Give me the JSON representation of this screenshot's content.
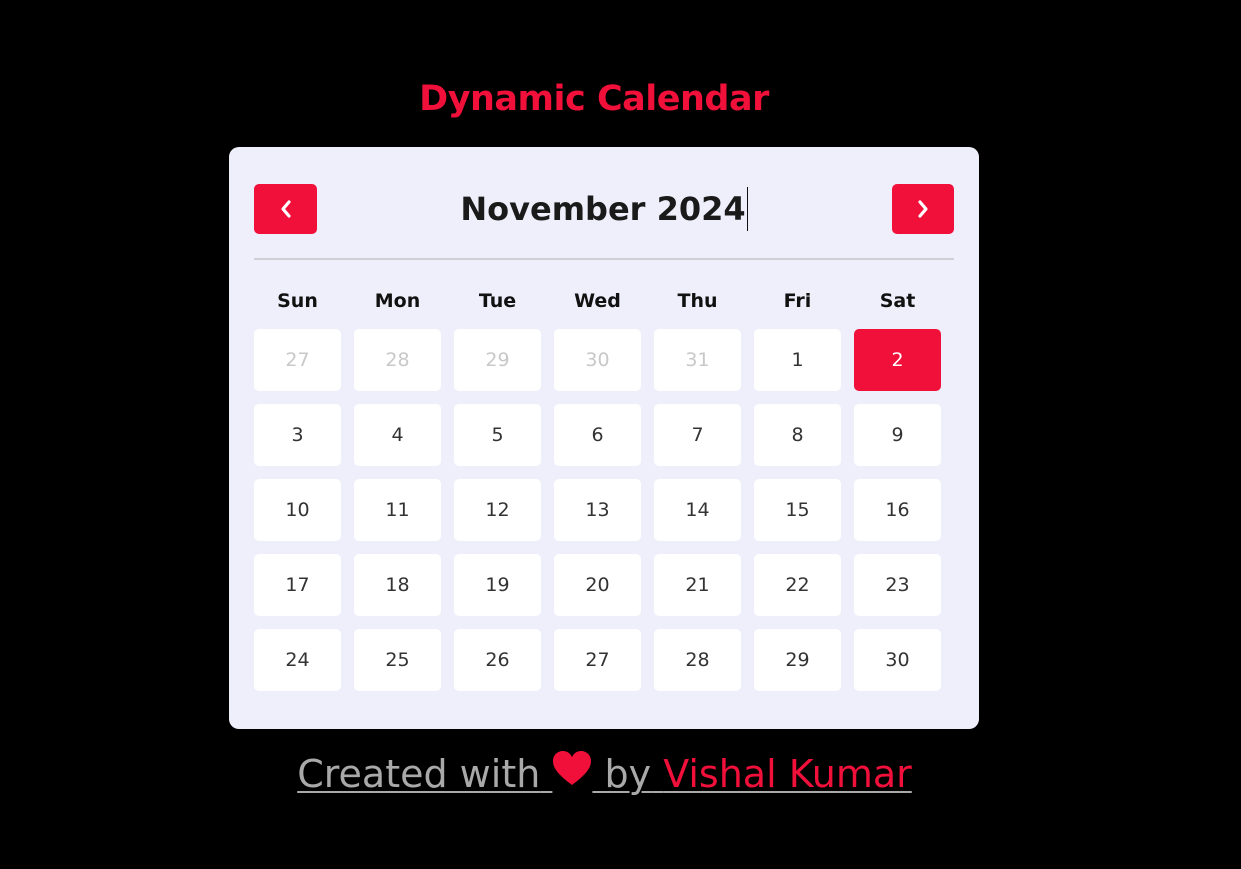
{
  "page": {
    "title": "Dynamic Calendar"
  },
  "calendar": {
    "month_label": "November 2024",
    "prev_icon": "chevron-left-icon",
    "next_icon": "chevron-right-icon",
    "weekdays": [
      "Sun",
      "Mon",
      "Tue",
      "Wed",
      "Thu",
      "Fri",
      "Sat"
    ],
    "weeks": [
      [
        {
          "label": "27",
          "state": "inactive"
        },
        {
          "label": "28",
          "state": "inactive"
        },
        {
          "label": "29",
          "state": "inactive"
        },
        {
          "label": "30",
          "state": "inactive"
        },
        {
          "label": "31",
          "state": "inactive"
        },
        {
          "label": "1",
          "state": "active"
        },
        {
          "label": "2",
          "state": "today"
        }
      ],
      [
        {
          "label": "3",
          "state": "active"
        },
        {
          "label": "4",
          "state": "active"
        },
        {
          "label": "5",
          "state": "active"
        },
        {
          "label": "6",
          "state": "active"
        },
        {
          "label": "7",
          "state": "active"
        },
        {
          "label": "8",
          "state": "active"
        },
        {
          "label": "9",
          "state": "active"
        }
      ],
      [
        {
          "label": "10",
          "state": "active"
        },
        {
          "label": "11",
          "state": "active"
        },
        {
          "label": "12",
          "state": "active"
        },
        {
          "label": "13",
          "state": "active"
        },
        {
          "label": "14",
          "state": "active"
        },
        {
          "label": "15",
          "state": "active"
        },
        {
          "label": "16",
          "state": "active"
        }
      ],
      [
        {
          "label": "17",
          "state": "active"
        },
        {
          "label": "18",
          "state": "active"
        },
        {
          "label": "19",
          "state": "active"
        },
        {
          "label": "20",
          "state": "active"
        },
        {
          "label": "21",
          "state": "active"
        },
        {
          "label": "22",
          "state": "active"
        },
        {
          "label": "23",
          "state": "active"
        }
      ],
      [
        {
          "label": "24",
          "state": "active"
        },
        {
          "label": "25",
          "state": "active"
        },
        {
          "label": "26",
          "state": "active"
        },
        {
          "label": "27",
          "state": "active"
        },
        {
          "label": "28",
          "state": "active"
        },
        {
          "label": "29",
          "state": "active"
        },
        {
          "label": "30",
          "state": "active"
        }
      ]
    ]
  },
  "footer": {
    "created_with": "Created with",
    "heart_icon": "heart-icon",
    "by": "by",
    "author": "Vishal Kumar"
  },
  "colors": {
    "accent": "#f0103a",
    "background": "#000000",
    "card": "#efeffb",
    "cell": "#ffffff",
    "muted_text": "#a9a9a9"
  }
}
